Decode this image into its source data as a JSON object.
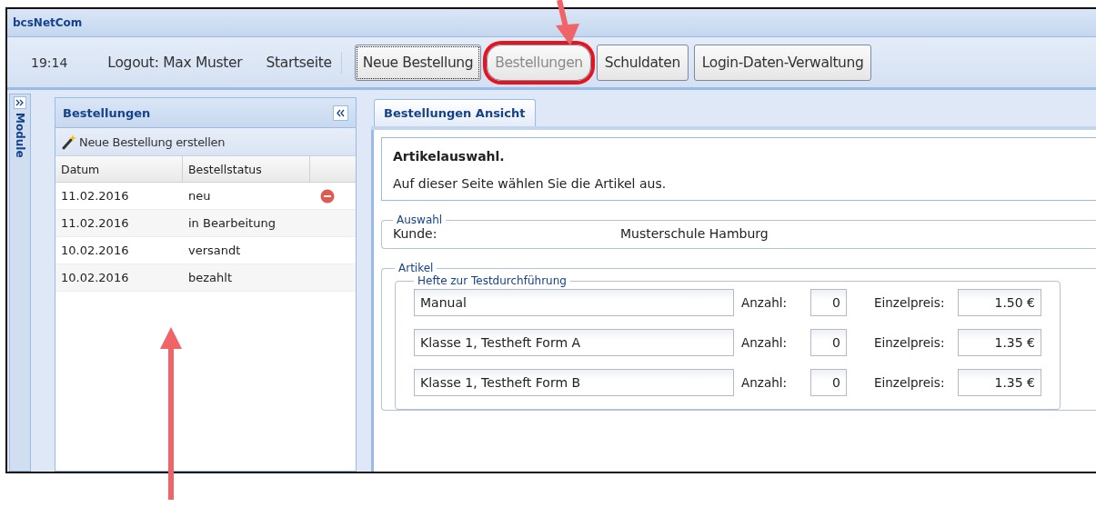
{
  "window": {
    "title": "bcsNetCom"
  },
  "toolbar": {
    "time": "19:14",
    "links": [
      "Logout: Max Muster",
      "Startseite"
    ],
    "buttons": [
      {
        "label": "Neue Bestellung",
        "focused": true,
        "disabled": false,
        "highlighted": false
      },
      {
        "label": "Bestellungen",
        "focused": false,
        "disabled": true,
        "highlighted": true
      },
      {
        "label": "Schuldaten",
        "focused": false,
        "disabled": false,
        "highlighted": false
      },
      {
        "label": "Login-Daten-Verwaltung",
        "focused": false,
        "disabled": false,
        "highlighted": false
      }
    ]
  },
  "module_strip": {
    "label": "Module"
  },
  "orders_panel": {
    "title": "Bestellungen",
    "action": "Neue Bestellung erstellen",
    "columns": [
      "Datum",
      "Bestellstatus"
    ],
    "rows": [
      {
        "date": "11.02.2016",
        "status": "neu",
        "removable": true
      },
      {
        "date": "11.02.2016",
        "status": "in Bearbeitung",
        "removable": false
      },
      {
        "date": "10.02.2016",
        "status": "versandt",
        "removable": false
      },
      {
        "date": "10.02.2016",
        "status": "bezahlt",
        "removable": false
      }
    ]
  },
  "tabs": [
    {
      "label": "Bestellungen Ansicht",
      "selected": true
    }
  ],
  "intro": {
    "heading": "Artikelauswahl.",
    "text": "Auf dieser Seite wählen Sie die Artikel aus."
  },
  "selection": {
    "legend": "Auswahl",
    "label": "Kunde:",
    "value": "Musterschule Hamburg"
  },
  "articles": {
    "legend": "Artikel",
    "group": "Hefte zur Testdurchführung",
    "items": [
      {
        "name": "Manual",
        "qty_label": "Anzahl:",
        "qty": "0",
        "price_label": "Einzelpreis:",
        "price": "1.50 €"
      },
      {
        "name": "Klasse 1, Testheft Form A",
        "qty_label": "Anzahl:",
        "qty": "0",
        "price_label": "Einzelpreis:",
        "price": "1.35 €"
      },
      {
        "name": "Klasse 1, Testheft Form B",
        "qty_label": "Anzahl:",
        "qty": "0",
        "price_label": "Einzelpreis:",
        "price": "1.35 €"
      }
    ]
  }
}
